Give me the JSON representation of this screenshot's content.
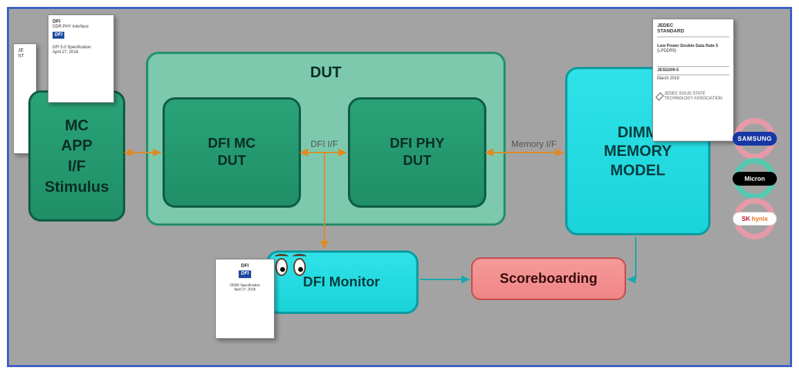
{
  "blocks": {
    "stimulus": {
      "l1": "MC",
      "l2": "APP",
      "l3": "I/F",
      "l4": "Stimulus"
    },
    "dut_container": "DUT",
    "dfi_mc": {
      "l1": "DFI MC",
      "l2": "DUT"
    },
    "dfi_phy": {
      "l1": "DFI PHY",
      "l2": "DUT"
    },
    "dimm": {
      "l1": "DIMM",
      "l2": "MEMORY",
      "l3": "MODEL"
    },
    "monitor": "DFI Monitor",
    "scoreboard": "Scoreboarding"
  },
  "labels": {
    "dfi_if": "DFI I/F",
    "mem_if": "Memory I/F"
  },
  "docs": {
    "dfi1": {
      "title": "DFI",
      "sub": "DDR PHY Interface",
      "logo": "DFI",
      "spec": "DFI 5.0 Specification",
      "date": "April 27, 2018"
    },
    "dfi2": {
      "title": "DFI",
      "logo": "DFI",
      "spec": "DDR5 Specification",
      "date": "April 27, 2018"
    },
    "jedec_back": {
      "t1": "JE",
      "t2": "ST"
    },
    "jedec": {
      "h1": "JEDEC",
      "h2": "STANDARD",
      "title": "Low Power Double Data Rate 5",
      "sub": "(LPDDR5)",
      "code": "JESD209-5",
      "date": "March 2019",
      "org": "JEDEC SOLID STATE TECHNOLOGY ASSOCIATION"
    }
  },
  "vendors": {
    "samsung": "SAMSUNG",
    "micron": "Micron",
    "hynix_prefix": "SK",
    "hynix": "hynix"
  }
}
